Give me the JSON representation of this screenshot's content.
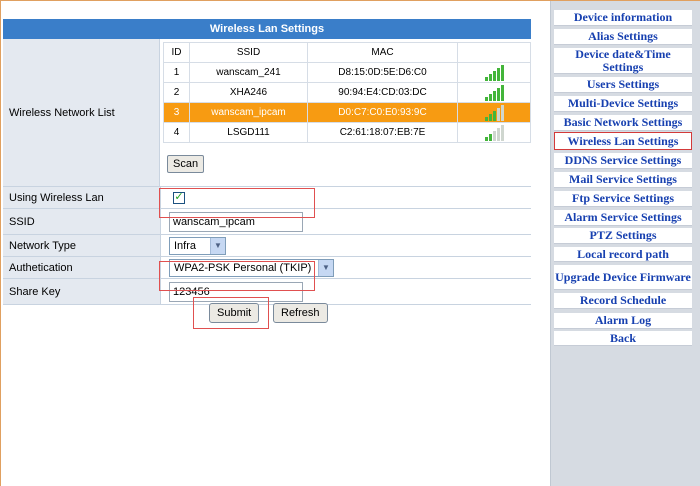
{
  "title": "Wireless Lan Settings",
  "wireless_list": {
    "label": "Wireless Network List",
    "headers": {
      "id": "ID",
      "ssid": "SSID",
      "mac": "MAC",
      "signal": ""
    },
    "rows": [
      {
        "id": "1",
        "ssid": "wanscam_241",
        "mac": "D8:15:0D:5E:D6:C0",
        "signal_bars": 5
      },
      {
        "id": "2",
        "ssid": "XHA246",
        "mac": "90:94:E4:CD:03:DC",
        "signal_bars": 5
      },
      {
        "id": "3",
        "ssid": "wanscam_ipcam",
        "mac": "D0:C7:C0:E0:93:9C",
        "signal_bars": 3
      },
      {
        "id": "4",
        "ssid": "LSGD111",
        "mac": "C2:61:18:07:EB:7E",
        "signal_bars": 2
      }
    ],
    "selected_row": 2,
    "scan_label": "Scan"
  },
  "fields": {
    "using_wireless_label": "Using Wireless Lan",
    "using_wireless_checked": true,
    "ssid_label": "SSID",
    "ssid_value": "wanscam_ipcam",
    "network_type_label": "Network Type",
    "network_type_value": "Infra",
    "auth_label": "Authetication",
    "auth_value": "WPA2-PSK Personal (TKIP)",
    "share_key_label": "Share Key",
    "share_key_value": "123456"
  },
  "buttons": {
    "submit": "Submit",
    "refresh": "Refresh"
  },
  "sidebar": {
    "items": [
      {
        "label": "Device information",
        "active": false
      },
      {
        "label": "Alias Settings",
        "active": false
      },
      {
        "label": "Device date&Time Settings",
        "active": false
      },
      {
        "label": "Users Settings",
        "active": false
      },
      {
        "label": "Multi-Device Settings",
        "active": false
      },
      {
        "label": "Basic Network Settings",
        "active": false
      },
      {
        "label": "Wireless Lan Settings",
        "active": true
      },
      {
        "label": "DDNS Service Settings",
        "active": false
      },
      {
        "label": "Mail Service Settings",
        "active": false
      },
      {
        "label": "Ftp Service Settings",
        "active": false
      },
      {
        "label": "Alarm Service Settings",
        "active": false
      },
      {
        "label": "PTZ Settings",
        "active": false
      },
      {
        "label": "Local record path",
        "active": false
      },
      {
        "label": "Upgrade Device Firmware",
        "active": false
      },
      {
        "label": "Record Schedule",
        "active": false
      },
      {
        "label": "Alarm Log",
        "active": false
      },
      {
        "label": "Back",
        "active": false
      }
    ]
  },
  "colors": {
    "title_bar": "#3a7ec9",
    "selected_row": "#f79b12",
    "sidebar_text": "#1740b0",
    "highlight_box": "#e05050"
  }
}
